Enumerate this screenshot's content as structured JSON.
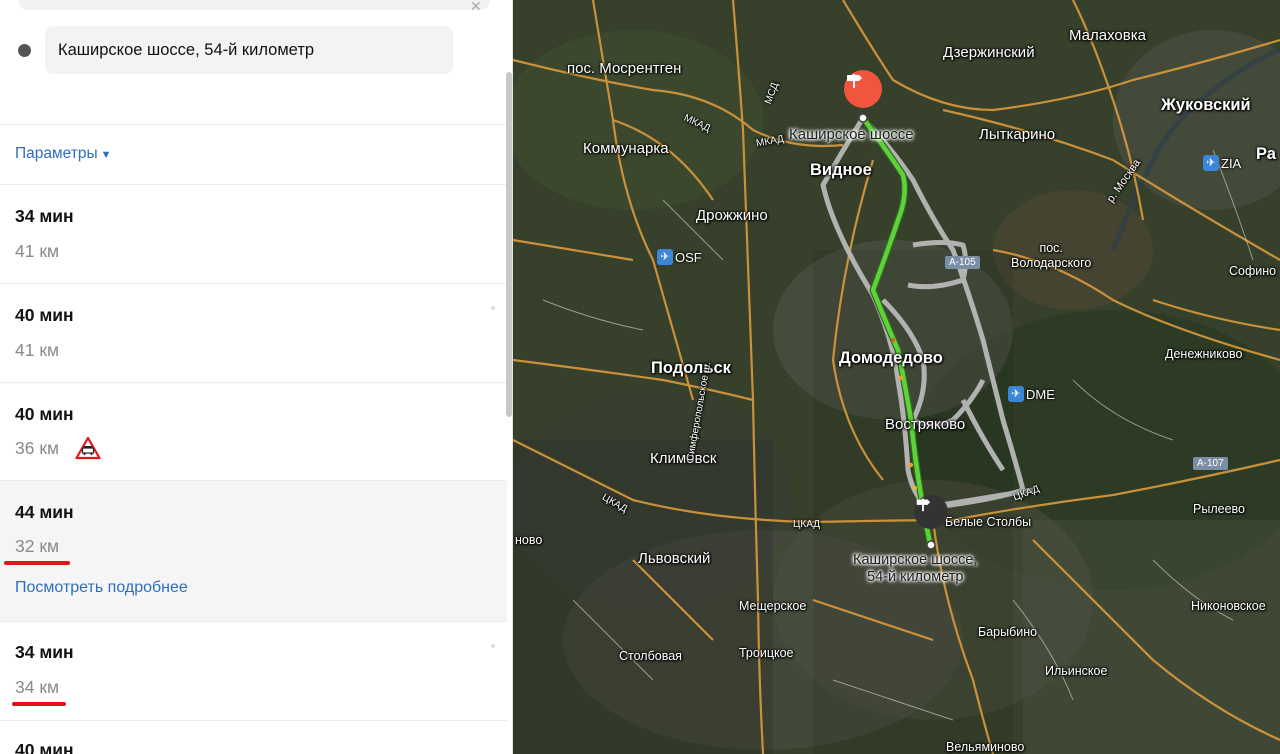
{
  "panel": {
    "destination_address": "Каширское шоссе, 54-й километр",
    "params_label": "Параметры",
    "routes": [
      {
        "time": "34 мин",
        "distance": "41 км",
        "selected": false
      },
      {
        "time": "40 мин",
        "distance": "41 км",
        "selected": false
      },
      {
        "time": "40 мин",
        "distance": "36 км",
        "selected": false,
        "warning": "railway-crossing"
      },
      {
        "time": "44 мин",
        "distance": "32 км",
        "selected": true,
        "details_link": "Посмотреть подробнее"
      },
      {
        "time": "34 мин",
        "distance": "34 км",
        "selected": false
      },
      {
        "time": "40 мин",
        "distance": "",
        "selected": false
      }
    ]
  },
  "map": {
    "places": {
      "mosrentgen": "пос. Мосрентген",
      "dzerzhinsky": "Дзержинский",
      "malakhovka": "Малаховка",
      "zhukovsky": "Жуковский",
      "ra": "Ра",
      "rastorguevo": "Расторгуевка",
      "kommunarka": "Коммунарка",
      "vidnoe": "Видное",
      "lytkarino": "Лыткарино",
      "drozhzhino": "Дрожжино",
      "volodarskogo": "пос.\nВолодарского",
      "sofino": "Софино",
      "podolsk": "Подольск",
      "domodedovo": "Домодедово",
      "denezhnikovo": "Денежниково",
      "vostryakovo": "Востряково",
      "klimovsk": "Климовск",
      "belye_stolby": "Белые Столбы",
      "rylyeevo": "Рылеево",
      "lvovsky": "Львовский",
      "mescherskoe": "Мещерское",
      "troitskoe": "Троицкое",
      "stolbovaya": "Столбовая",
      "barybino": "Барыбино",
      "ilyinskoe": "Ильинское",
      "nikonovskoe": "Никоновское",
      "velyaminovo": "Вельяминово",
      "novo": "ново"
    },
    "roads": {
      "mkad": "МКАД",
      "msd": "МСД",
      "ckad": "ЦКАД",
      "simferopol": "Симферопольское ш.",
      "a105": "А-105",
      "a107": "А-107",
      "moskva_river": "р. Москва"
    },
    "airports": {
      "osf": "OSF",
      "dme": "DME",
      "zia": "ZIA"
    },
    "start_label": "Каширское шоссе",
    "end_label": "Каширское шоссе,\n54-й километр",
    "route_color": "#5fd13a",
    "alt_route_color": "#c9c9c9",
    "pin_start_color": "#f0553d"
  }
}
